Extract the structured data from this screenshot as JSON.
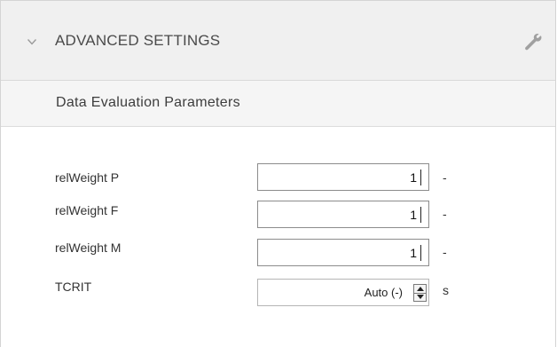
{
  "header": {
    "title": "ADVANCED SETTINGS",
    "toggle_icon": "chevron-down-icon",
    "tool_icon": "wrench-icon"
  },
  "section": {
    "title": "Data Evaluation Parameters"
  },
  "params": [
    {
      "label": "relWeight P",
      "value": "1",
      "unit": "-"
    },
    {
      "label": "relWeight F",
      "value": "1",
      "unit": "-"
    },
    {
      "label": "relWeight M",
      "value": "1",
      "unit": "-"
    }
  ],
  "tcrit": {
    "label": "TCRIT",
    "value": "Auto (-)",
    "unit": "s",
    "spinner_icons": [
      "arrow-up-icon",
      "arrow-down-icon"
    ]
  },
  "colors": {
    "header_bg": "#f0f0f0",
    "section_bg": "#f5f5f5",
    "border": "#8c8c8c"
  }
}
